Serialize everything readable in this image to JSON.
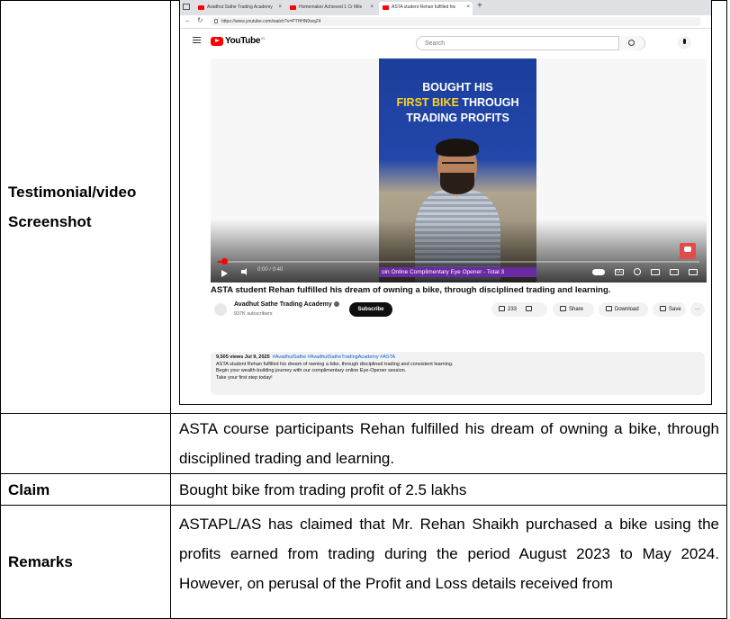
{
  "rows": {
    "testimonial_label_line1": "Testimonial/video",
    "testimonial_label_line2": "Screenshot",
    "testimonial_caption": "ASTA course participants Rehan fulfilled his dream of owning a bike, through disciplined trading and learning.",
    "claim_label": "Claim",
    "claim_text": "Bought bike from trading profit of 2.5 lakhs",
    "remarks_label": "Remarks",
    "remarks_text": "ASTAPL/AS has claimed that Mr. Rehan Shaikh purchased a bike using the profits earned from trading during the period August 2023 to May 2024. However, on perusal of the Profit and Loss details received from"
  },
  "browser": {
    "tabs": [
      {
        "label": "Avadhut Sathe Trading Academy"
      },
      {
        "label": "Homemaker Achieved 1 Cr Mile"
      },
      {
        "label": "ASTA student Rehan fulfilled his"
      }
    ],
    "new_tab": "+",
    "url": "https://www.youtube.com/watch?v=PTHHN0wqZ4"
  },
  "youtube": {
    "logo_text": "YouTube",
    "logo_region": "IN",
    "search_placeholder": "Search",
    "thumbnail": {
      "line1": "BOUGHT HIS",
      "line2_highlight": "FIRST BIKE",
      "line2_rest": " THROUGH",
      "line3": "TRADING PROFITS"
    },
    "player_time": "0:00 / 0:40",
    "ticker_text": "oin Online Complimentary Eye Opener - Total 3",
    "video_title": "ASTA student Rehan fulfilled his dream of owning a bike, through disciplined trading and learning.",
    "channel_name": "Avadhut Sathe Trading Academy",
    "channel_subs": "937K subscribers",
    "subscribe_label": "Subscribe",
    "like_count": "233",
    "share_label": "Share",
    "download_label": "Download",
    "save_label": "Save",
    "more_label": "···",
    "desc_meta": "9,505 views  Jul 9, 2025",
    "desc_tags": "#AvadhutSathe #AvadhutSatheTradingAcademy #ASTA",
    "desc_line1": "ASTA student Rehan fulfilled his dream of owning a bike, through disciplined trading and consistent learning.",
    "desc_line2": "Begin your wealth-building journey with our complimentary online Eye-Opener session.",
    "desc_line3": "Take your first step today!"
  }
}
